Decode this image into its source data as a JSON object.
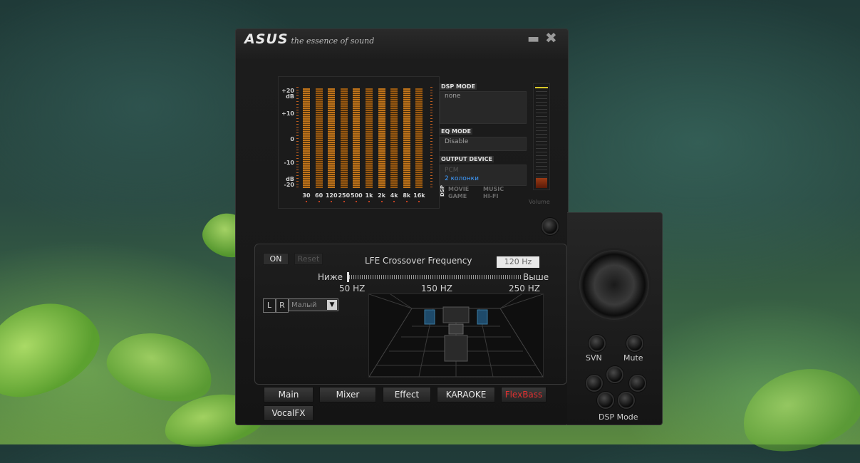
{
  "app": {
    "brand": "ASUS",
    "tagline": "the essence of sound"
  },
  "window": {
    "minimize_icon": "minimize-icon",
    "close_icon": "close-icon"
  },
  "eq": {
    "db_labels": [
      "+20",
      "dB",
      "+10",
      "0",
      "-10",
      "dB",
      "-20"
    ],
    "bands": [
      "30",
      "60",
      "120",
      "250",
      "500",
      "1k",
      "2k",
      "4k",
      "8k",
      "16k"
    ],
    "levels_db": [
      0,
      0,
      0,
      0,
      0,
      0,
      0,
      0,
      0,
      0
    ]
  },
  "info": {
    "dsp_mode_header": "DSP MODE",
    "dsp_mode_value": "none",
    "eq_mode_header": "EQ MODE",
    "eq_mode_value": "Disable",
    "output_device_header": "OUTPUT DEVICE",
    "output_device_options": [
      "PCM",
      "2 колонки"
    ],
    "output_device_selected": "2 колонки",
    "dsp_vertical": "DSP",
    "modes": [
      "MOVIE",
      "MUSIC",
      "GAME",
      "HI-FI"
    ]
  },
  "volume": {
    "label": "Volume",
    "level_fraction": 0.1
  },
  "lfe": {
    "on_label": "ON",
    "reset_label": "Reset",
    "title": "LFE Crossover Frequency",
    "value": "120 Hz",
    "lower_label": "Ниже",
    "higher_label": "Выше",
    "ticks": [
      "50 HZ",
      "150 HZ",
      "250 HZ"
    ],
    "left_label": "L",
    "right_label": "R",
    "size_value": "Малый"
  },
  "tabs": {
    "main": "Main",
    "mixer": "Mixer",
    "effect": "Effect",
    "karaoke": "KARAOKE",
    "flexbass": "FlexBass",
    "vocalfx": "VocalFX"
  },
  "side": {
    "svn_label": "SVN",
    "mute_label": "Mute",
    "dsp_mode_label": "DSP Mode"
  },
  "colors": {
    "accent_orange": "#c0741a",
    "selected_blue": "#3d9bff",
    "flexbass_red": "#e03030"
  }
}
